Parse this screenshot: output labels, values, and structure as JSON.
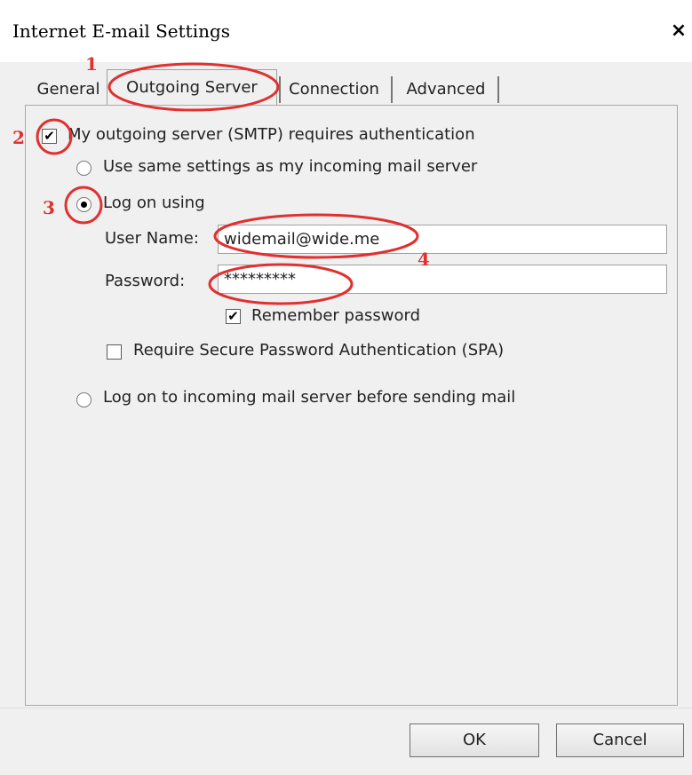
{
  "window": {
    "title": "Internet E-mail Settings",
    "close_glyph": "×"
  },
  "tabs": [
    {
      "label": "General"
    },
    {
      "label": "Outgoing Server",
      "selected": true
    },
    {
      "label": "Connection"
    },
    {
      "label": "Advanced"
    }
  ],
  "options": {
    "smtp_auth": {
      "label": "My outgoing server (SMTP) requires authentication",
      "checked": true,
      "check_glyph": "✔"
    },
    "same_settings": {
      "label": "Use same settings as my incoming mail server",
      "selected": false
    },
    "log_on_using": {
      "label": "Log on using",
      "selected": true
    },
    "user_name": {
      "label": "User Name:",
      "value": "widemail@wide.me"
    },
    "password": {
      "label": "Password:",
      "value": "*********"
    },
    "remember_password": {
      "label": "Remember password",
      "checked": true
    },
    "require_spa": {
      "label": "Require Secure Password Authentication (SPA)",
      "checked": false
    },
    "log_on_incoming": {
      "label": "Log on to incoming mail server before sending mail",
      "selected": false
    }
  },
  "buttons": {
    "ok": "OK",
    "cancel": "Cancel"
  },
  "annotations": {
    "color": "#e03030",
    "markers": [
      "1",
      "2",
      "3",
      "4"
    ]
  }
}
